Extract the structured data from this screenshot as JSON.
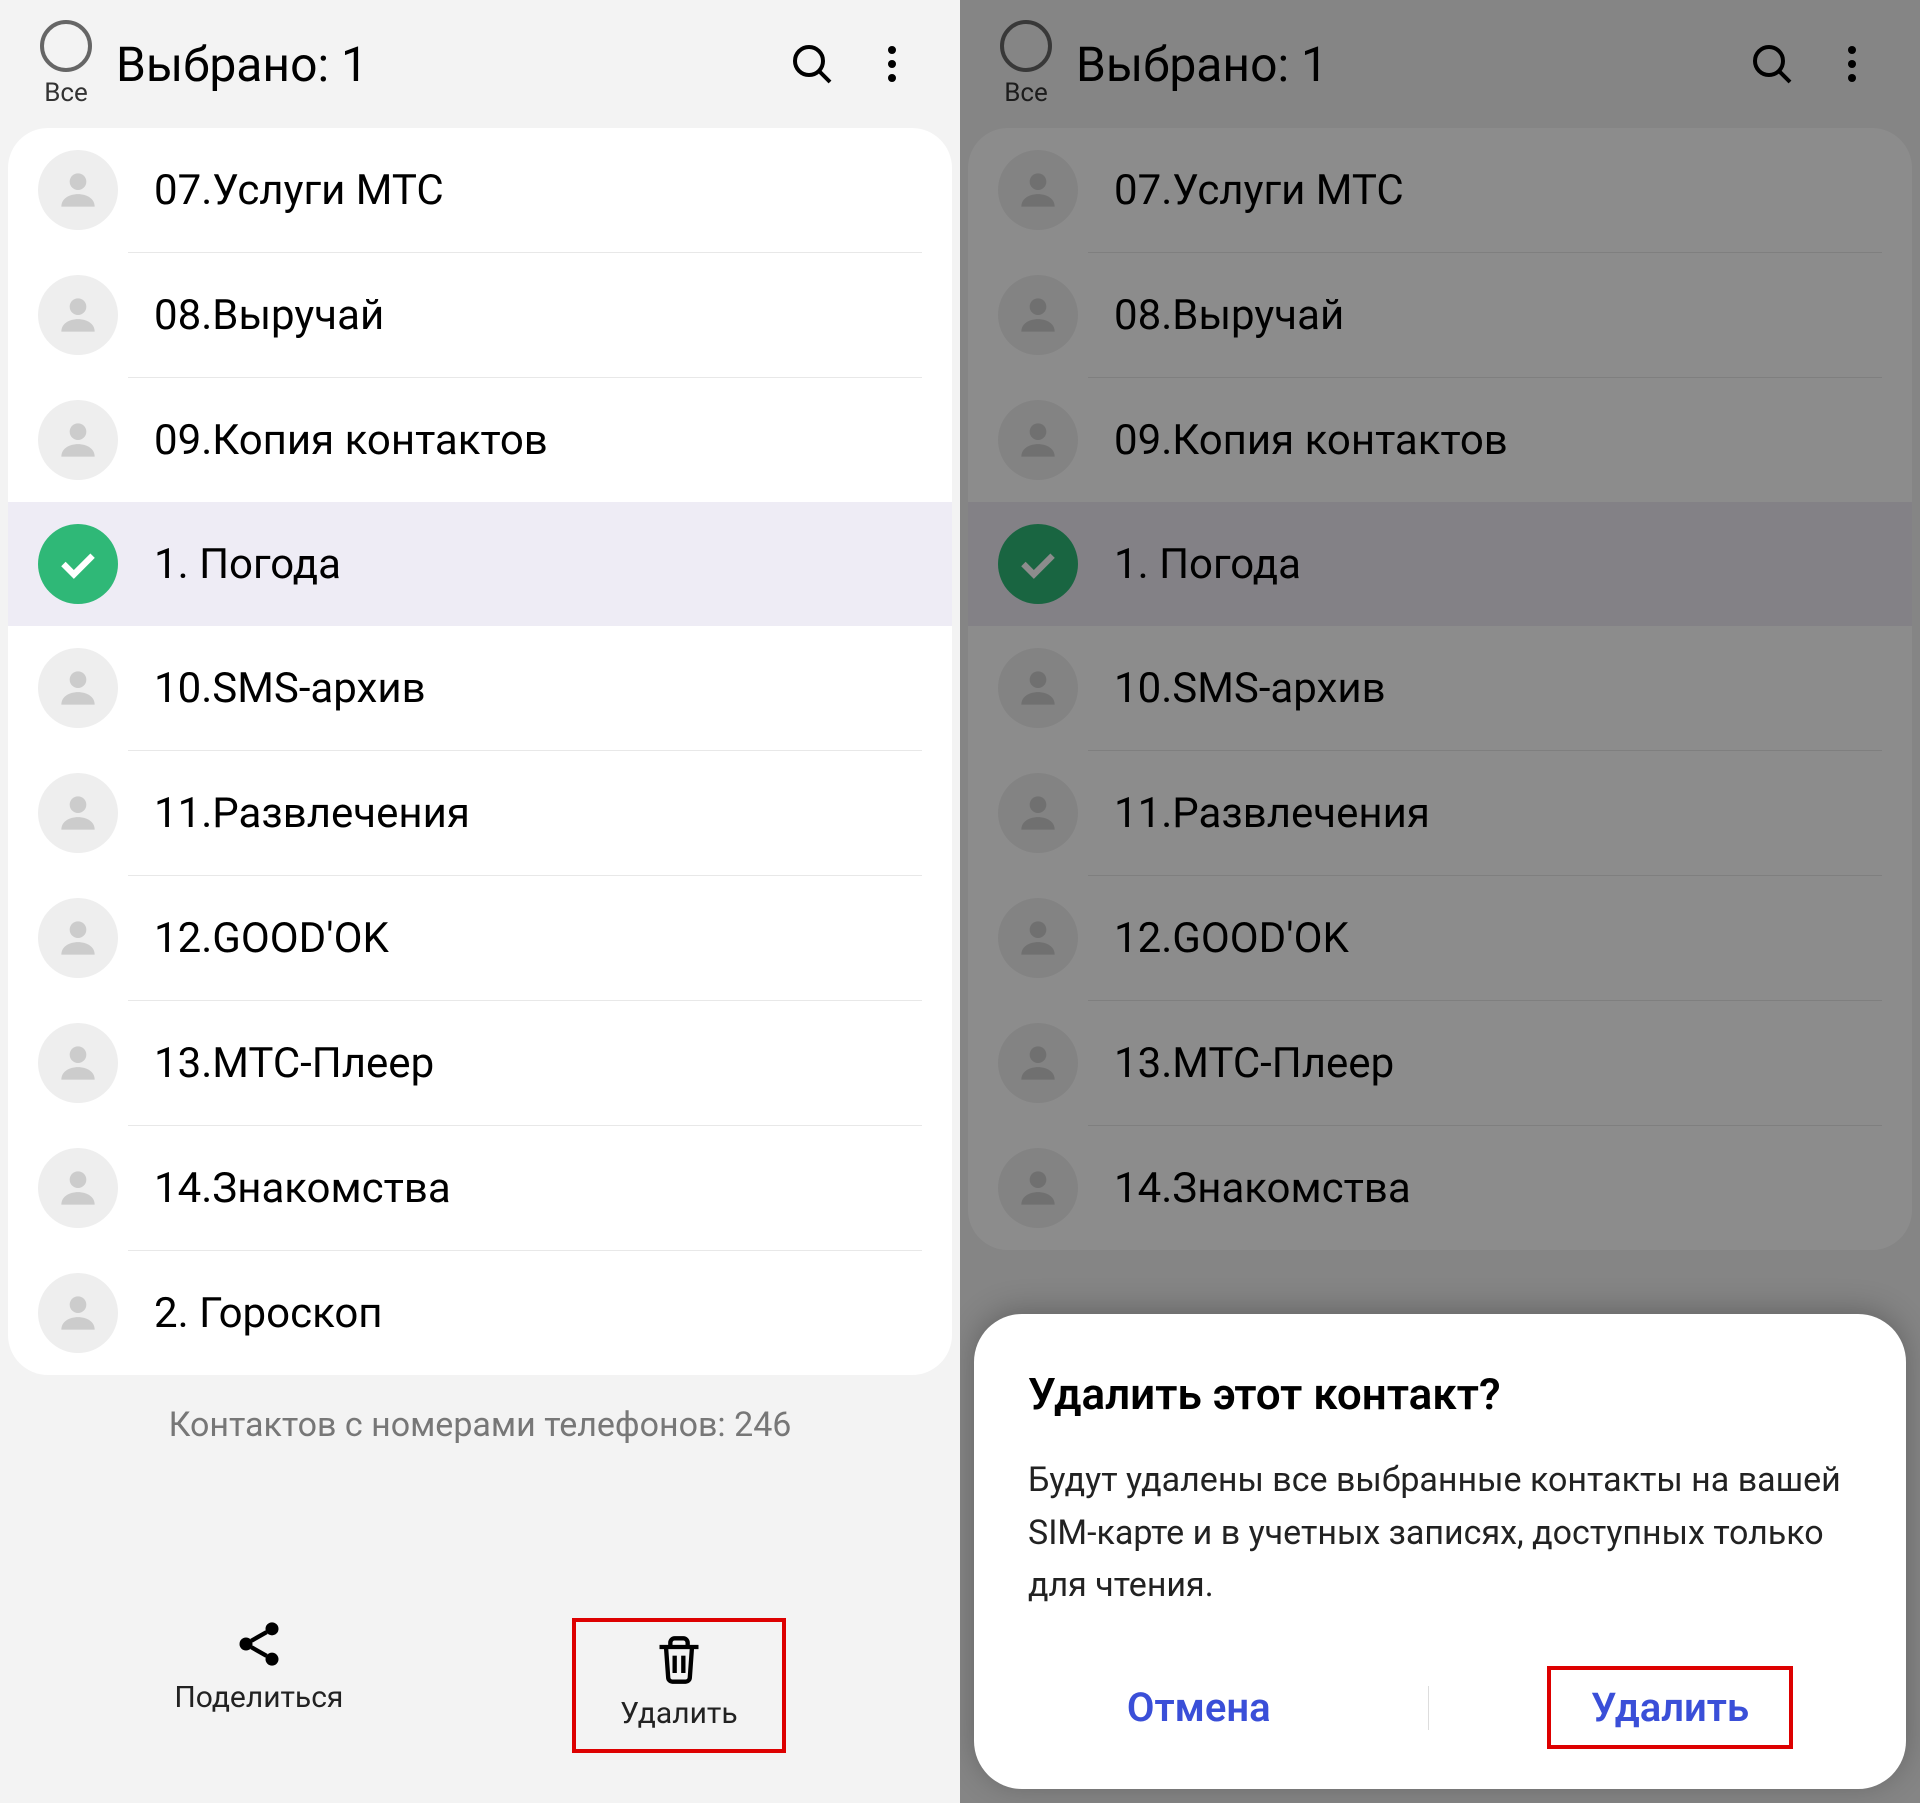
{
  "header": {
    "all_label": "Все",
    "title": "Выбрано: 1"
  },
  "contacts": [
    {
      "name": "07.Услуги МТС",
      "selected": false
    },
    {
      "name": "08.Выручай",
      "selected": false
    },
    {
      "name": "09.Копия контактов",
      "selected": false
    },
    {
      "name": "1. Погода",
      "selected": true
    },
    {
      "name": "10.SMS-архив",
      "selected": false
    },
    {
      "name": "11.Развлечения",
      "selected": false
    },
    {
      "name": "12.GOOD'OK",
      "selected": false
    },
    {
      "name": "13.МТС-Плеер",
      "selected": false
    },
    {
      "name": "14.Знакомства",
      "selected": false
    },
    {
      "name": "2. Гороскоп",
      "selected": false
    }
  ],
  "footer_text": "Контактов с номерами телефонов: 246",
  "bottom": {
    "share": "Поделиться",
    "delete": "Удалить"
  },
  "dialog": {
    "title": "Удалить этот контакт?",
    "body": "Будут удалены все выбранные контакты на вашей SIM-карте и в учетных записях, доступных только для чтения.",
    "cancel": "Отмена",
    "confirm": "Удалить"
  }
}
